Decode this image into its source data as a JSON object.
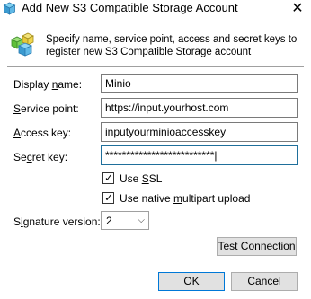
{
  "window": {
    "title": "Add New S3 Compatible Storage Account",
    "close_glyph": "✕"
  },
  "header": {
    "icon": "storage-cubes-icon",
    "text_line1": "Specify name, service point, access and secret keys to",
    "text_line2": "register new S3 Compatible Storage account"
  },
  "form": {
    "display_name": {
      "label_pre": "Display ",
      "label_u": "n",
      "label_post": "ame:",
      "value": "Minio"
    },
    "service_point": {
      "label_pre": "",
      "label_u": "S",
      "label_post": "ervice point:",
      "value": "https://input.yourhost.com"
    },
    "access_key": {
      "label_pre": "",
      "label_u": "A",
      "label_post": "ccess key:",
      "value": "inputyourminioaccesskey"
    },
    "secret_key": {
      "label_pre": "Se",
      "label_u": "c",
      "label_post": "ret key:",
      "value": "**************************|"
    },
    "use_ssl": {
      "label_pre": "Use ",
      "label_u": "S",
      "label_post": "SL",
      "checked": true,
      "glyph": "✓"
    },
    "use_multipart": {
      "label_pre": "Use native ",
      "label_u": "m",
      "label_post": "ultipart upload",
      "checked": true,
      "glyph": "✓"
    },
    "signature_version": {
      "label_pre": "S",
      "label_u": "i",
      "label_post": "gnature version:",
      "value": "2",
      "arrow": "⌵"
    }
  },
  "buttons": {
    "test_connection": {
      "label_u": "T",
      "label_post": "est Connection"
    },
    "ok": "OK",
    "cancel": "Cancel"
  },
  "colors": {
    "focus_border": "#1f6f9b",
    "default_button_border": "#0078d7"
  }
}
